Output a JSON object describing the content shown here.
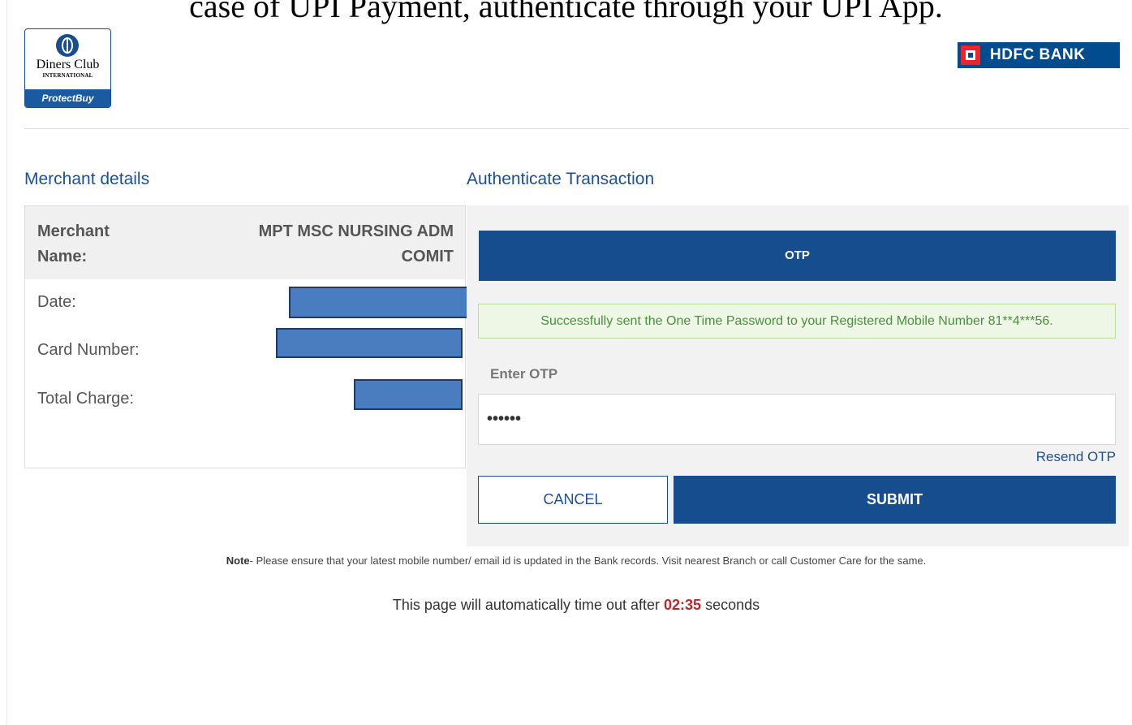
{
  "banner": {
    "text": "case of UPI Payment, authenticate through your UPI App."
  },
  "logos": {
    "diners_line1": "Diners Club",
    "diners_line2": "INTERNATIONAL",
    "diners_protect": "ProtectBuy",
    "hdfc": "HDFC BANK"
  },
  "merchant": {
    "section_title": "Merchant details",
    "name_label": "Merchant Name:",
    "name_value": "MPT MSC NURSING ADM COMIT",
    "date_label": "Date:",
    "card_label": "Card Number:",
    "charge_label": "Total Charge:"
  },
  "auth": {
    "section_title": "Authenticate Transaction",
    "tab_label": "OTP",
    "success_message": "Successfully sent the One Time Password to your Registered Mobile Number 81**4***56.",
    "otp_label": "Enter OTP",
    "otp_value": "••••••",
    "resend_label": "Resend OTP",
    "cancel_label": "CANCEL",
    "submit_label": "SUBMIT"
  },
  "footer": {
    "note_prefix": "Note",
    "note_text": "- Please ensure that your latest mobile number/ email id is updated in the Bank records. Visit nearest Branch or call Customer Care for the same.",
    "timeout_prefix": "This page will automatically time out after ",
    "timeout_value": "02:35",
    "timeout_suffix": " seconds"
  },
  "colors": {
    "primary_blue": "#164d8f",
    "success_green": "#4a8f3c",
    "timer_red": "#c0272d",
    "hdfc_red": "#ed232a"
  }
}
